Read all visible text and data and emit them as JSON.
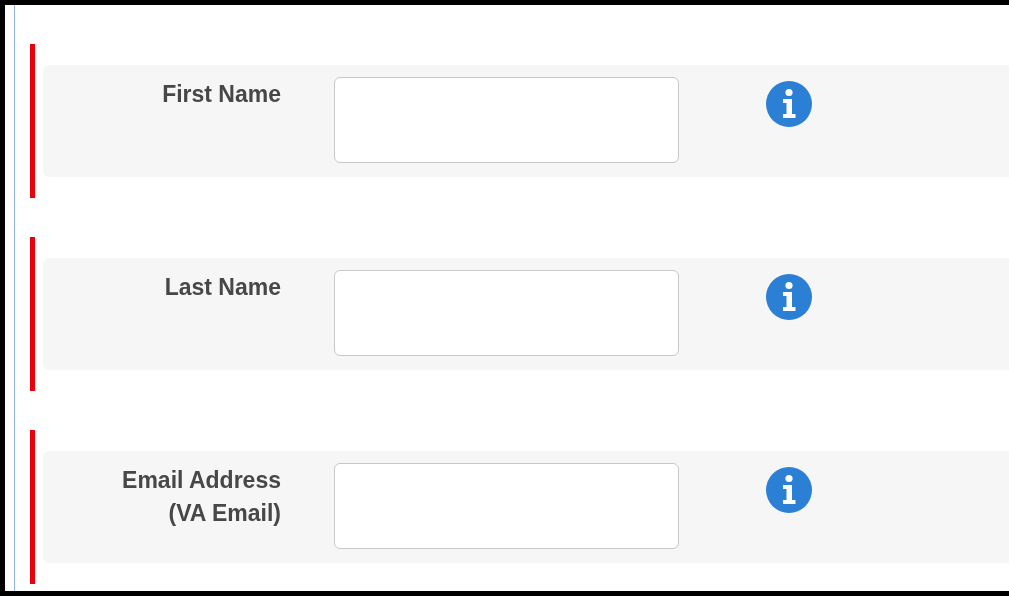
{
  "fields": [
    {
      "label": "First Name",
      "required": true
    },
    {
      "label": "Last Name",
      "required": true
    },
    {
      "label": "Email Address\n(VA Email)",
      "required": true
    }
  ]
}
